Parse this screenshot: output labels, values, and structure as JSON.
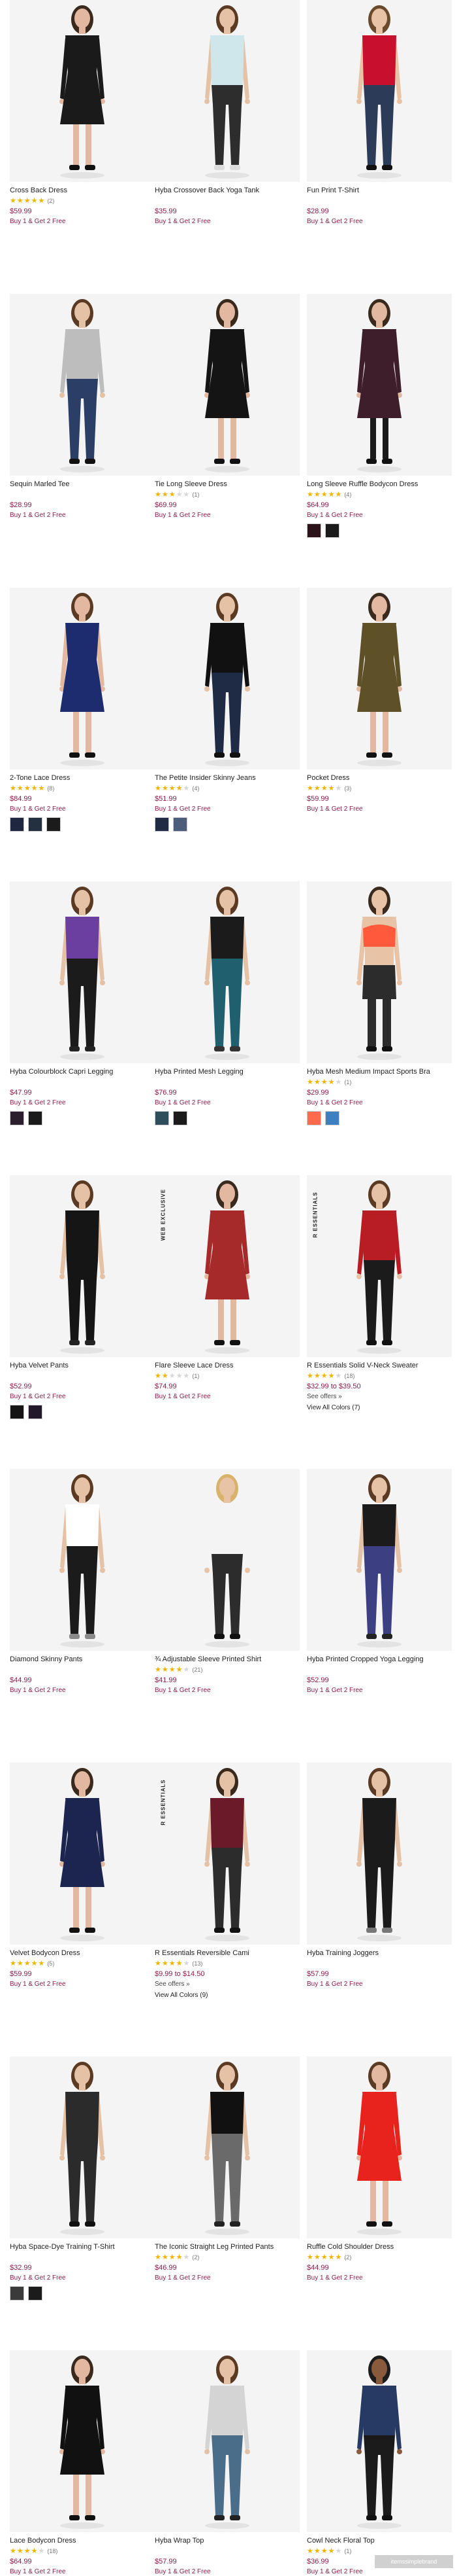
{
  "products": [
    {
      "name": "Cross Back Dress",
      "rating": 5,
      "count": "(2)",
      "price": "$59.99",
      "promo": "Buy 1 & Get 2 Free",
      "swatches": [],
      "figure": {
        "top": "#1a1a1a",
        "bottom": "#1a1a1a",
        "legs": "#e2b9a0",
        "shoes": "#111",
        "skin": "#e2b9a0",
        "hair": "#3a2a1e",
        "type": "dress",
        "sleeve": true
      }
    },
    {
      "name": "Hyba Crossover Back Yoga Tank",
      "rating": 0,
      "count": "",
      "price": "$35.99",
      "promo": "Buy 1 & Get 2 Free",
      "swatches": [],
      "figure": {
        "top": "#cfe7ea",
        "bottom": "#2d2d2d",
        "legs": "#2d2d2d",
        "shoes": "#dcdcdc",
        "skin": "#e5c1a5",
        "hair": "#5b3a23",
        "type": "crop",
        "sleeve": false
      }
    },
    {
      "name": "Fun Print T-Shirt",
      "rating": 0,
      "count": "",
      "price": "$28.99",
      "promo": "Buy 1 & Get 2 Free",
      "swatches": [],
      "figure": {
        "top": "#c8102e",
        "bottom": "#2c3b57",
        "legs": "#2c3b57",
        "shoes": "#111",
        "skin": "#e8c3a6",
        "hair": "#6a4a2c",
        "type": "crop",
        "sleeve": false
      }
    },
    {
      "name": "Sequin Marled Tee",
      "rating": 0,
      "count": "",
      "price": "$28.99",
      "promo": "Buy 1 & Get 2 Free",
      "swatches": [],
      "figure": {
        "top": "#bdbdbd",
        "bottom": "#2b3f66",
        "legs": "#2b3f66",
        "shoes": "#111",
        "skin": "#e5c1a5",
        "hair": "#5b3a23",
        "type": "crop",
        "sleeve": true
      }
    },
    {
      "name": "Tie Long Sleeve Dress",
      "rating": 3,
      "count": "(1)",
      "price": "$69.99",
      "promo": "Buy 1 & Get 2 Free",
      "swatches": [],
      "figure": {
        "top": "#141414",
        "bottom": "#141414",
        "legs": "#e2b9a0",
        "shoes": "#111",
        "skin": "#e2b9a0",
        "hair": "#3a2a1e",
        "type": "dress",
        "sleeve": true
      }
    },
    {
      "name": "Long Sleeve Ruffle Bodycon Dress",
      "rating": 5,
      "count": "(4)",
      "price": "$64.99",
      "promo": "Buy 1 & Get 2 Free",
      "swatches": [
        "#2a1419",
        "#1b1b1b"
      ],
      "figure": {
        "top": "#3d1e2a",
        "bottom": "#3d1e2a",
        "legs": "#1a1a1a",
        "shoes": "#111",
        "skin": "#e2b9a0",
        "hair": "#3a2a1e",
        "type": "dress",
        "sleeve": true
      }
    },
    {
      "name": "2-Tone Lace Dress",
      "rating": 5,
      "count": "(8)",
      "price": "$84.99",
      "promo": "Buy 1 & Get 2 Free",
      "swatches": [
        "#1e2640",
        "#23303f",
        "#1b1b1b"
      ],
      "figure": {
        "top": "#1d2c6e",
        "bottom": "#1d2c6e",
        "legs": "#e2b9a0",
        "shoes": "#111",
        "skin": "#e2b9a0",
        "hair": "#5b3a23",
        "type": "dress",
        "sleeve": false
      }
    },
    {
      "name": "The Petite Insider Skinny Jeans",
      "rating": 4,
      "count": "(4)",
      "price": "$51.99",
      "promo": "Buy 1 & Get 2 Free",
      "swatches": [
        "#1f2a44",
        "#4d5e7c"
      ],
      "figure": {
        "top": "#111111",
        "bottom": "#1f2a44",
        "legs": "#1f2a44",
        "shoes": "#111",
        "skin": "#e5c1a5",
        "hair": "#5b3a23",
        "type": "pants",
        "sleeve": true
      }
    },
    {
      "name": "Pocket Dress",
      "rating": 4,
      "count": "(3)",
      "price": "$59.99",
      "promo": "Buy 1 & Get 2 Free",
      "swatches": [],
      "figure": {
        "top": "#5e5127",
        "bottom": "#5e5127",
        "legs": "#e2b9a0",
        "shoes": "#111",
        "skin": "#e2b9a0",
        "hair": "#3a2a1e",
        "type": "dress",
        "sleeve": true
      }
    },
    {
      "name": "Hyba Colourblock Capri Legging",
      "rating": 0,
      "count": "",
      "price": "$47.99",
      "promo": "Buy 1 & Get 2 Free",
      "swatches": [
        "#2b1f2e",
        "#1b1b1b"
      ],
      "figure": {
        "top": "#6b3fa0",
        "bottom": "#1b1b1b",
        "legs": "#1b1b1b",
        "shoes": "#222",
        "skin": "#e5c1a5",
        "hair": "#5b3a23",
        "type": "legs",
        "sleeve": false
      }
    },
    {
      "name": "Hyba Printed Mesh Legging",
      "rating": 0,
      "count": "",
      "price": "$76.99",
      "promo": "Buy 1 & Get 2 Free",
      "swatches": [
        "#2f4e5b",
        "#1b1b1b"
      ],
      "figure": {
        "top": "#1b1b1b",
        "bottom": "#1f5f6e",
        "legs": "#1f5f6e",
        "shoes": "#333",
        "skin": "#e5c1a5",
        "hair": "#5b3a23",
        "type": "legs",
        "sleeve": false
      }
    },
    {
      "name": "Hyba Mesh Medium Impact Sports Bra",
      "rating": 4,
      "count": "(1)",
      "price": "$29.99",
      "promo": "Buy 1 & Get 2 Free",
      "swatches": [
        "#ff6a4d",
        "#3d7fc1"
      ],
      "figure": {
        "top": "#ff5a3c",
        "bottom": "#2c2c2c",
        "legs": "#2c2c2c",
        "shoes": "#111",
        "skin": "#e8c3a6",
        "hair": "#3a2a1e",
        "type": "bra",
        "sleeve": false
      }
    },
    {
      "name": "Hyba Velvet Pants",
      "rating": 0,
      "count": "",
      "price": "$52.99",
      "promo": "Buy 1 & Get 2 Free",
      "swatches": [
        "#151515",
        "#221a2b"
      ],
      "figure": {
        "top": "#151515",
        "bottom": "#151515",
        "legs": "#151515",
        "shoes": "#222",
        "skin": "#e5c1a5",
        "hair": "#5b3a23",
        "type": "pants",
        "sleeve": false
      }
    },
    {
      "name": "Flare Sleeve Lace Dress",
      "rating": 2,
      "count": "(1)",
      "price": "$74.99",
      "promo": "Buy 1 & Get 2 Free",
      "swatches": [],
      "badge": "WEB EXCLUSIVE",
      "figure": {
        "top": "#a62a2a",
        "bottom": "#a62a2a",
        "legs": "#e2b9a0",
        "shoes": "#111",
        "skin": "#e2b9a0",
        "hair": "#3a2a1e",
        "type": "dress",
        "sleeve": true
      }
    },
    {
      "name": "R Essentials Solid V-Neck Sweater",
      "rating": 4,
      "count": "(18)",
      "price": "$32.99 to $39.50",
      "see_offers": "See offers »",
      "view_colors": "View All Colors (7)",
      "swatches": [],
      "badge": "R ESSENTIALS",
      "figure": {
        "top": "#b81d24",
        "bottom": "#1b1b1b",
        "legs": "#1b1b1b",
        "shoes": "#111",
        "skin": "#e5c1a5",
        "hair": "#5b3a23",
        "type": "crop",
        "sleeve": true
      }
    },
    {
      "name": "Diamond Skinny Pants",
      "rating": 0,
      "count": "",
      "price": "$44.99",
      "promo": "Buy 1 & Get 2 Free",
      "swatches": [],
      "figure": {
        "top": "#ffffff",
        "bottom": "#1b1b1b",
        "legs": "#1b1b1b",
        "shoes": "#8a8a8a",
        "skin": "#e5c1a5",
        "hair": "#5b3a23",
        "type": "legs",
        "sleeve": false
      }
    },
    {
      "name": "¾ Adjustable Sleeve Printed Shirt",
      "rating": 4,
      "count": "(21)",
      "price": "$41.99",
      "promo": "Buy 1 & Get 2 Free",
      "swatches": [],
      "figure": {
        "top": "#f4f4f4",
        "bottom": "#2c2c2c",
        "legs": "#2c2c2c",
        "shoes": "#111",
        "skin": "#e8c3a6",
        "hair": "#d9b26b",
        "type": "crop",
        "sleeve": true
      }
    },
    {
      "name": "Hyba Printed Cropped Yoga Legging",
      "rating": 0,
      "count": "",
      "price": "$52.99",
      "promo": "Buy 1 & Get 2 Free",
      "swatches": [],
      "figure": {
        "top": "#1b1b1b",
        "bottom": "#3d3f83",
        "legs": "#3d3f83",
        "shoes": "#222",
        "skin": "#e5c1a5",
        "hair": "#5b3a23",
        "type": "legs",
        "sleeve": false
      }
    },
    {
      "name": "Velvet Bodycon Dress",
      "rating": 5,
      "count": "(5)",
      "price": "$59.99",
      "promo": "Buy 1 & Get 2 Free",
      "swatches": [],
      "figure": {
        "top": "#1c2450",
        "bottom": "#1c2450",
        "legs": "#e2b9a0",
        "shoes": "#111",
        "skin": "#e2b9a0",
        "hair": "#3a2a1e",
        "type": "dress",
        "sleeve": true
      }
    },
    {
      "name": "R Essentials Reversible Cami",
      "rating": 4,
      "count": "(13)",
      "price": "$9.99 to $14.50",
      "see_offers": "See offers »",
      "view_colors": "View All Colors (9)",
      "swatches": [],
      "badge": "R ESSENTIALS",
      "figure": {
        "top": "#6b1a2a",
        "bottom": "#2c2c2c",
        "legs": "#2c2c2c",
        "shoes": "#111",
        "skin": "#e5c1a5",
        "hair": "#3a2a1e",
        "type": "crop",
        "sleeve": false
      }
    },
    {
      "name": "Hyba Training Joggers",
      "rating": 0,
      "count": "",
      "price": "$57.99",
      "promo": "Buy 1 & Get 2 Free",
      "swatches": [],
      "figure": {
        "top": "#1b1b1b",
        "bottom": "#1b1b1b",
        "legs": "#1b1b1b",
        "shoes": "#777",
        "skin": "#e5c1a5",
        "hair": "#5b3a23",
        "type": "legs",
        "sleeve": false
      }
    },
    {
      "name": "Hyba Space-Dye Training T-Shirt",
      "rating": 0,
      "count": "",
      "price": "$32.99",
      "promo": "Buy 1 & Get 2 Free",
      "swatches": [
        "#3a3a3a",
        "#1b1b1b"
      ],
      "figure": {
        "top": "#2b2b2b",
        "bottom": "#2b2b2b",
        "legs": "#2b2b2b",
        "shoes": "#111",
        "skin": "#e5c1a5",
        "hair": "#5b3a23",
        "type": "crop",
        "sleeve": false
      }
    },
    {
      "name": "The Iconic Straight Leg Printed Pants",
      "rating": 4,
      "count": "(2)",
      "price": "$46.99",
      "promo": "Buy 1 & Get 2 Free",
      "swatches": [],
      "figure": {
        "top": "#111111",
        "bottom": "#6a6a6a",
        "legs": "#6a6a6a",
        "shoes": "#222",
        "skin": "#e5c1a5",
        "hair": "#5b3a23",
        "type": "legs",
        "sleeve": false
      }
    },
    {
      "name": "Ruffle Cold Shoulder Dress",
      "rating": 5,
      "count": "(2)",
      "price": "$44.99",
      "promo": "Buy 1 & Get 2 Free",
      "swatches": [],
      "figure": {
        "top": "#e8231d",
        "bottom": "#e8231d",
        "legs": "#e2b9a0",
        "shoes": "#111",
        "skin": "#e2b9a0",
        "hair": "#5b3a23",
        "type": "dress",
        "sleeve": true
      }
    },
    {
      "name": "Lace Bodycon Dress",
      "rating": 4,
      "count": "(18)",
      "price": "$64.99",
      "promo": "Buy 1 & Get 2 Free",
      "swatches": [],
      "figure": {
        "top": "#111111",
        "bottom": "#111111",
        "legs": "#e2b9a0",
        "shoes": "#111",
        "skin": "#e2b9a0",
        "hair": "#3a2a1e",
        "type": "dress",
        "sleeve": true
      }
    },
    {
      "name": "Hyba Wrap Top",
      "rating": 0,
      "count": "",
      "price": "$57.99",
      "promo": "Buy 1 & Get 2 Free",
      "swatches": [],
      "figure": {
        "top": "#d4d4d4",
        "bottom": "#4a6d8a",
        "legs": "#4a6d8a",
        "shoes": "#222",
        "skin": "#e5c1a5",
        "hair": "#5b3a23",
        "type": "crop",
        "sleeve": true
      }
    },
    {
      "name": "Cowl Neck Floral Top",
      "rating": 4,
      "count": "(1)",
      "price": "$36.99",
      "promo": "Buy 1 & Get 2 Free",
      "swatches": [],
      "figure": {
        "top": "#263a63",
        "bottom": "#1b1b1b",
        "legs": "#1b1b1b",
        "shoes": "#111",
        "skin": "#8a5a3c",
        "hair": "#1c1c1c",
        "type": "crop",
        "sleeve": true
      }
    }
  ],
  "watermark_text": "itemssimplebrand"
}
